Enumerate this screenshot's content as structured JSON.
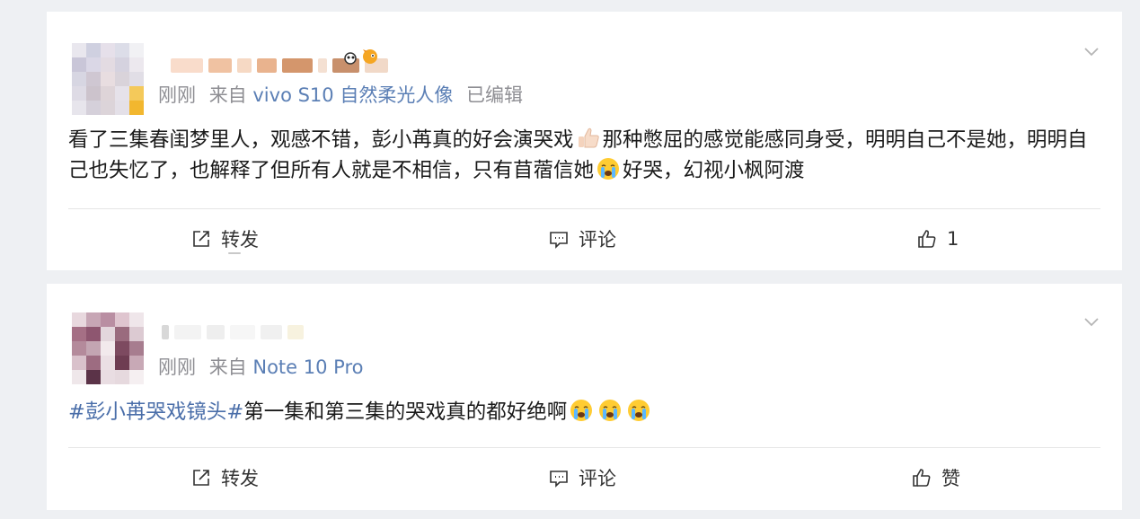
{
  "posts": [
    {
      "time": "刚刚",
      "source_prefix": "来自",
      "device": "vivo S10 自然柔光人像",
      "edited": "已编辑",
      "text_part1": "看了三集春闺梦里人，观感不错，彭小苒真的好会演哭戏",
      "text_part2": "那种憋屈的感觉能感同身受，明明自己不是她，明明自己也失忆了，也解释了但所有人就是不相信，只有苜蓿信她",
      "text_part3": "好哭，幻视小枫阿渡",
      "actions": {
        "repost": "转发",
        "comment": "评论",
        "like": "1"
      }
    },
    {
      "time": "刚刚",
      "source_prefix": "来自",
      "device": "Note 10 Pro",
      "topic": "#彭小苒哭戏镜头#",
      "text": "第一集和第三集的哭戏真的都好绝啊",
      "actions": {
        "repost": "转发",
        "comment": "评论",
        "like": "赞"
      }
    }
  ],
  "icons": {
    "repost": "edit-share-icon",
    "comment": "comment-icon",
    "like": "thumbs-up-icon",
    "menu": "chevron-down-icon",
    "emoji_thumb": "thumbs-up-emoji",
    "emoji_cry": "crying-emoji"
  },
  "colors": {
    "link": "#4a6ea9",
    "device": "#5b7fb5",
    "meta": "#8e8e93"
  }
}
